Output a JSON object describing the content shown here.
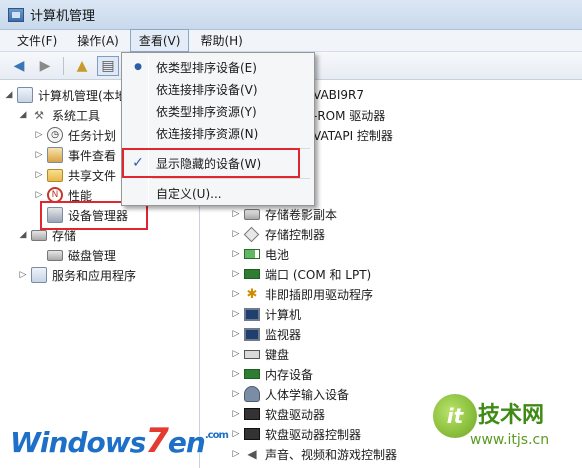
{
  "window": {
    "title": "计算机管理"
  },
  "menubar": {
    "items": [
      {
        "label": "文件(F)"
      },
      {
        "label": "操作(A)"
      },
      {
        "label": "查看(V)"
      },
      {
        "label": "帮助(H)"
      }
    ]
  },
  "toolbar": {
    "icons": [
      "back-arrow-icon",
      "forward-arrow-icon",
      "up-folder-icon",
      "show-hide-tree-icon"
    ]
  },
  "view_menu": {
    "items": [
      {
        "label": "依类型排序设备(E)",
        "mark": "●"
      },
      {
        "label": "依连接排序设备(V)",
        "mark": ""
      },
      {
        "label": "依类型排序资源(Y)",
        "mark": ""
      },
      {
        "label": "依连接排序资源(N)",
        "mark": ""
      },
      {
        "label": "显示隐藏的设备(W)",
        "mark": "✓"
      },
      {
        "label": "自定义(U)...",
        "mark": ""
      }
    ]
  },
  "left_tree": {
    "root": "计算机管理(本地",
    "system_tools": "系统工具",
    "task_scheduler": "任务计划",
    "event_viewer": "事件查看",
    "shared_folders": "共享文件",
    "performance": "性能",
    "device_manager": "设备管理器",
    "storage": "存储",
    "disk_management": "磁盘管理",
    "services": "服务和应用程序"
  },
  "right_top": {
    "computer_name": "VABI9R7",
    "dvd_rom": "-ROM 驱动器",
    "ide_ata": "VATAPI 控制器"
  },
  "devices": [
    {
      "label": "存储卷影副本",
      "icon": "storage-shadow-icon"
    },
    {
      "label": "存储控制器",
      "icon": "storage-controller-icon"
    },
    {
      "label": "电池",
      "icon": "battery-icon"
    },
    {
      "label": "端口 (COM 和 LPT)",
      "icon": "port-icon"
    },
    {
      "label": "非即插即用驱动程序",
      "icon": "non-pnp-driver-icon"
    },
    {
      "label": "计算机",
      "icon": "computer-icon"
    },
    {
      "label": "监视器",
      "icon": "monitor-icon"
    },
    {
      "label": "键盘",
      "icon": "keyboard-icon"
    },
    {
      "label": "内存设备",
      "icon": "memory-icon"
    },
    {
      "label": "人体学输入设备",
      "icon": "hid-icon"
    },
    {
      "label": "软盘驱动器",
      "icon": "floppy-drive-icon"
    },
    {
      "label": "软盘驱动器控制器",
      "icon": "floppy-controller-icon"
    },
    {
      "label": "声音、视频和游戏控制器",
      "icon": "sound-icon"
    }
  ],
  "watermarks": {
    "left_a": "Windows",
    "left_b": "7",
    "left_c": "en",
    "left_d": ".com",
    "right_logo": "it",
    "right_text": "技术网",
    "right_url": "www.itjs.cn"
  },
  "colors": {
    "highlight": "#e0262e",
    "menu_mark": "#2a5ea8"
  }
}
